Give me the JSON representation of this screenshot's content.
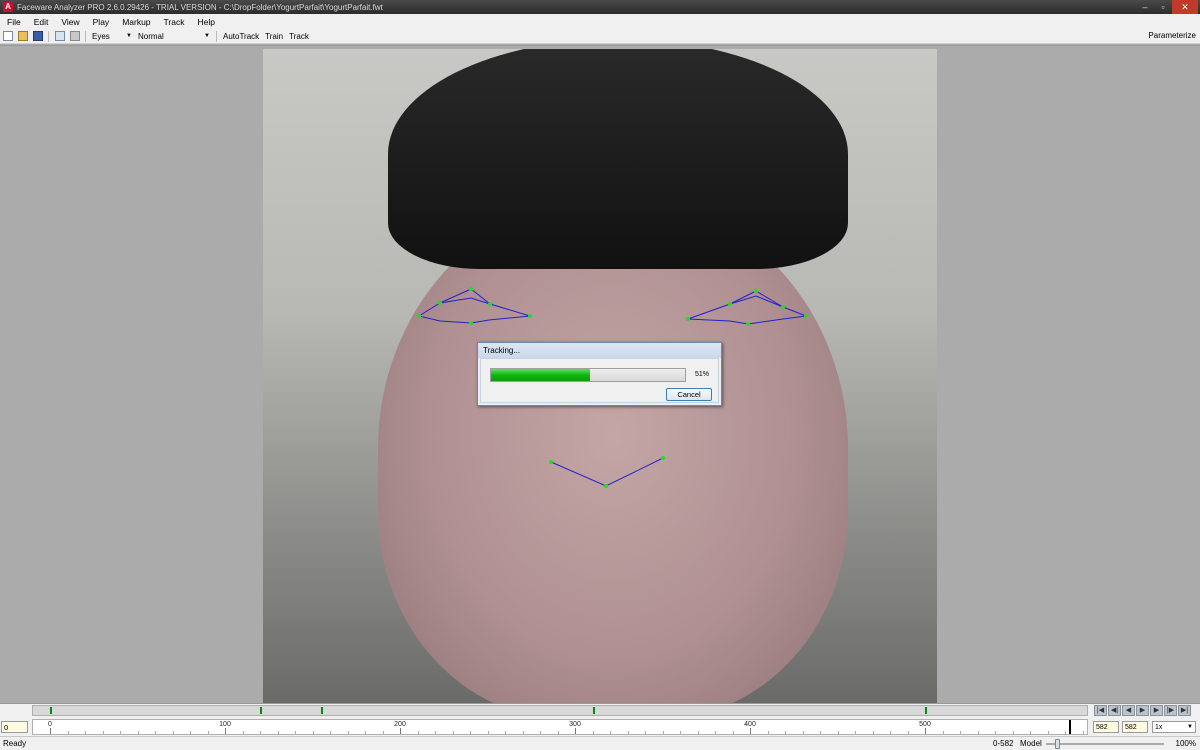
{
  "window": {
    "title": "Faceware Analyzer PRO 2.6.0.29426 - TRIAL VERSION - C:\\DropFolder\\YogurtParfait\\YogurtParfait.fwt",
    "app_icon_glyph": "A",
    "controls": {
      "minimize": "–",
      "maximize": "▫",
      "close": "✕"
    }
  },
  "menubar": {
    "items": [
      "File",
      "Edit",
      "View",
      "Play",
      "Markup",
      "Track",
      "Help"
    ]
  },
  "toolbar": {
    "icons": [
      "new-file-icon",
      "open-folder-icon",
      "save-icon",
      "copy-icon",
      "print-icon"
    ],
    "region_select": "Eyes",
    "mode_select": "Normal",
    "autotrack_label": "AutoTrack",
    "train_label": "Train",
    "track_label": "Track",
    "parameterize_label": "Parameterize"
  },
  "dialog": {
    "title": "Tracking...",
    "progress_percent": 51,
    "progress_label": "51%",
    "cancel_label": "Cancel"
  },
  "timeline": {
    "current_frame": "0",
    "range_min": 0,
    "range_max": 582,
    "tick_labels": [
      "0",
      "100",
      "200",
      "300",
      "400",
      "500"
    ],
    "keyframes": [
      0,
      120,
      155,
      310,
      500,
      598
    ],
    "playhead_frame": 582,
    "transport_icons": [
      "go-to-start-icon",
      "step-back-icon",
      "prev-key-icon",
      "play-icon",
      "next-key-icon",
      "step-forward-icon",
      "go-to-end-icon"
    ],
    "range_start": "582",
    "range_end": "582",
    "speed": "1x"
  },
  "statusbar": {
    "status": "Ready",
    "frame_range": "0-582",
    "mode": "Model",
    "zoom": "100%"
  },
  "colors": {
    "tracking_line": "#2222c8",
    "tracking_point": "#22dd22",
    "progress_fill": "#12b512",
    "keyframe": "#0a8a0a"
  }
}
